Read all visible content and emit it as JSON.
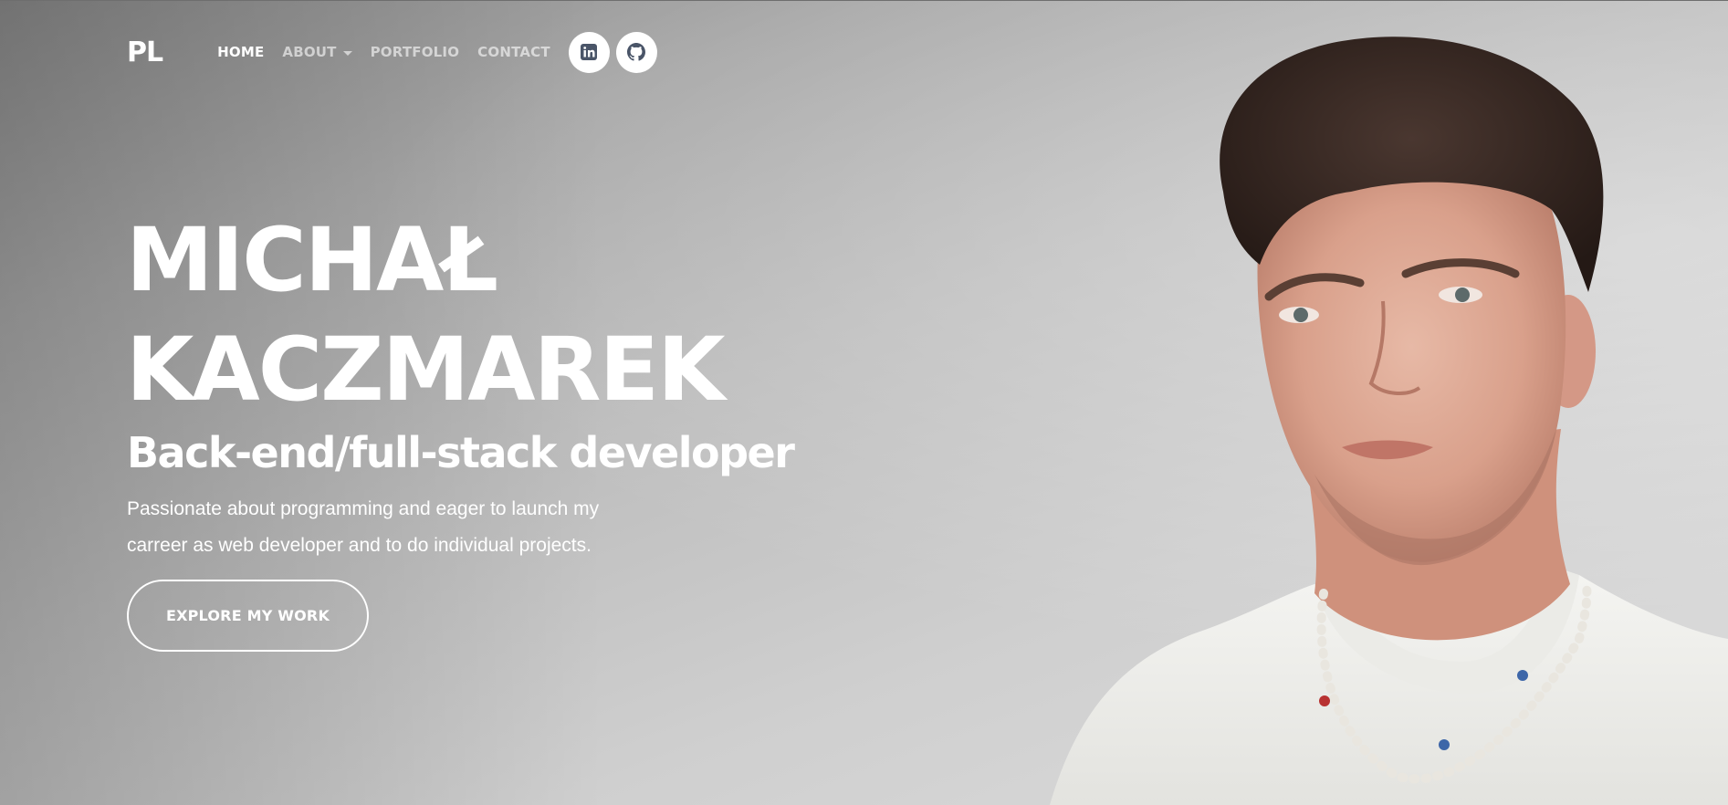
{
  "navbar": {
    "brand": "PL",
    "links": [
      {
        "label": "HOME",
        "active": true
      },
      {
        "label": "ABOUT",
        "dropdown": true
      },
      {
        "label": "PORTFOLIO"
      },
      {
        "label": "CONTACT"
      }
    ],
    "social": [
      {
        "icon": "linkedin-icon"
      },
      {
        "icon": "github-icon"
      }
    ]
  },
  "hero": {
    "name_line1": "MICHAŁ",
    "name_line2": "KACZMAREK",
    "subtitle": "Back-end/full-stack developer",
    "description": "Passionate about programming and eager to launch my carreer as web developer and to do individual projects.",
    "cta_label": "EXPLORE MY WORK"
  },
  "colors": {
    "text": "#ffffff",
    "icon": "#4a5568",
    "background_start": "#8b8b8b",
    "background_end": "#dcdcdc"
  }
}
